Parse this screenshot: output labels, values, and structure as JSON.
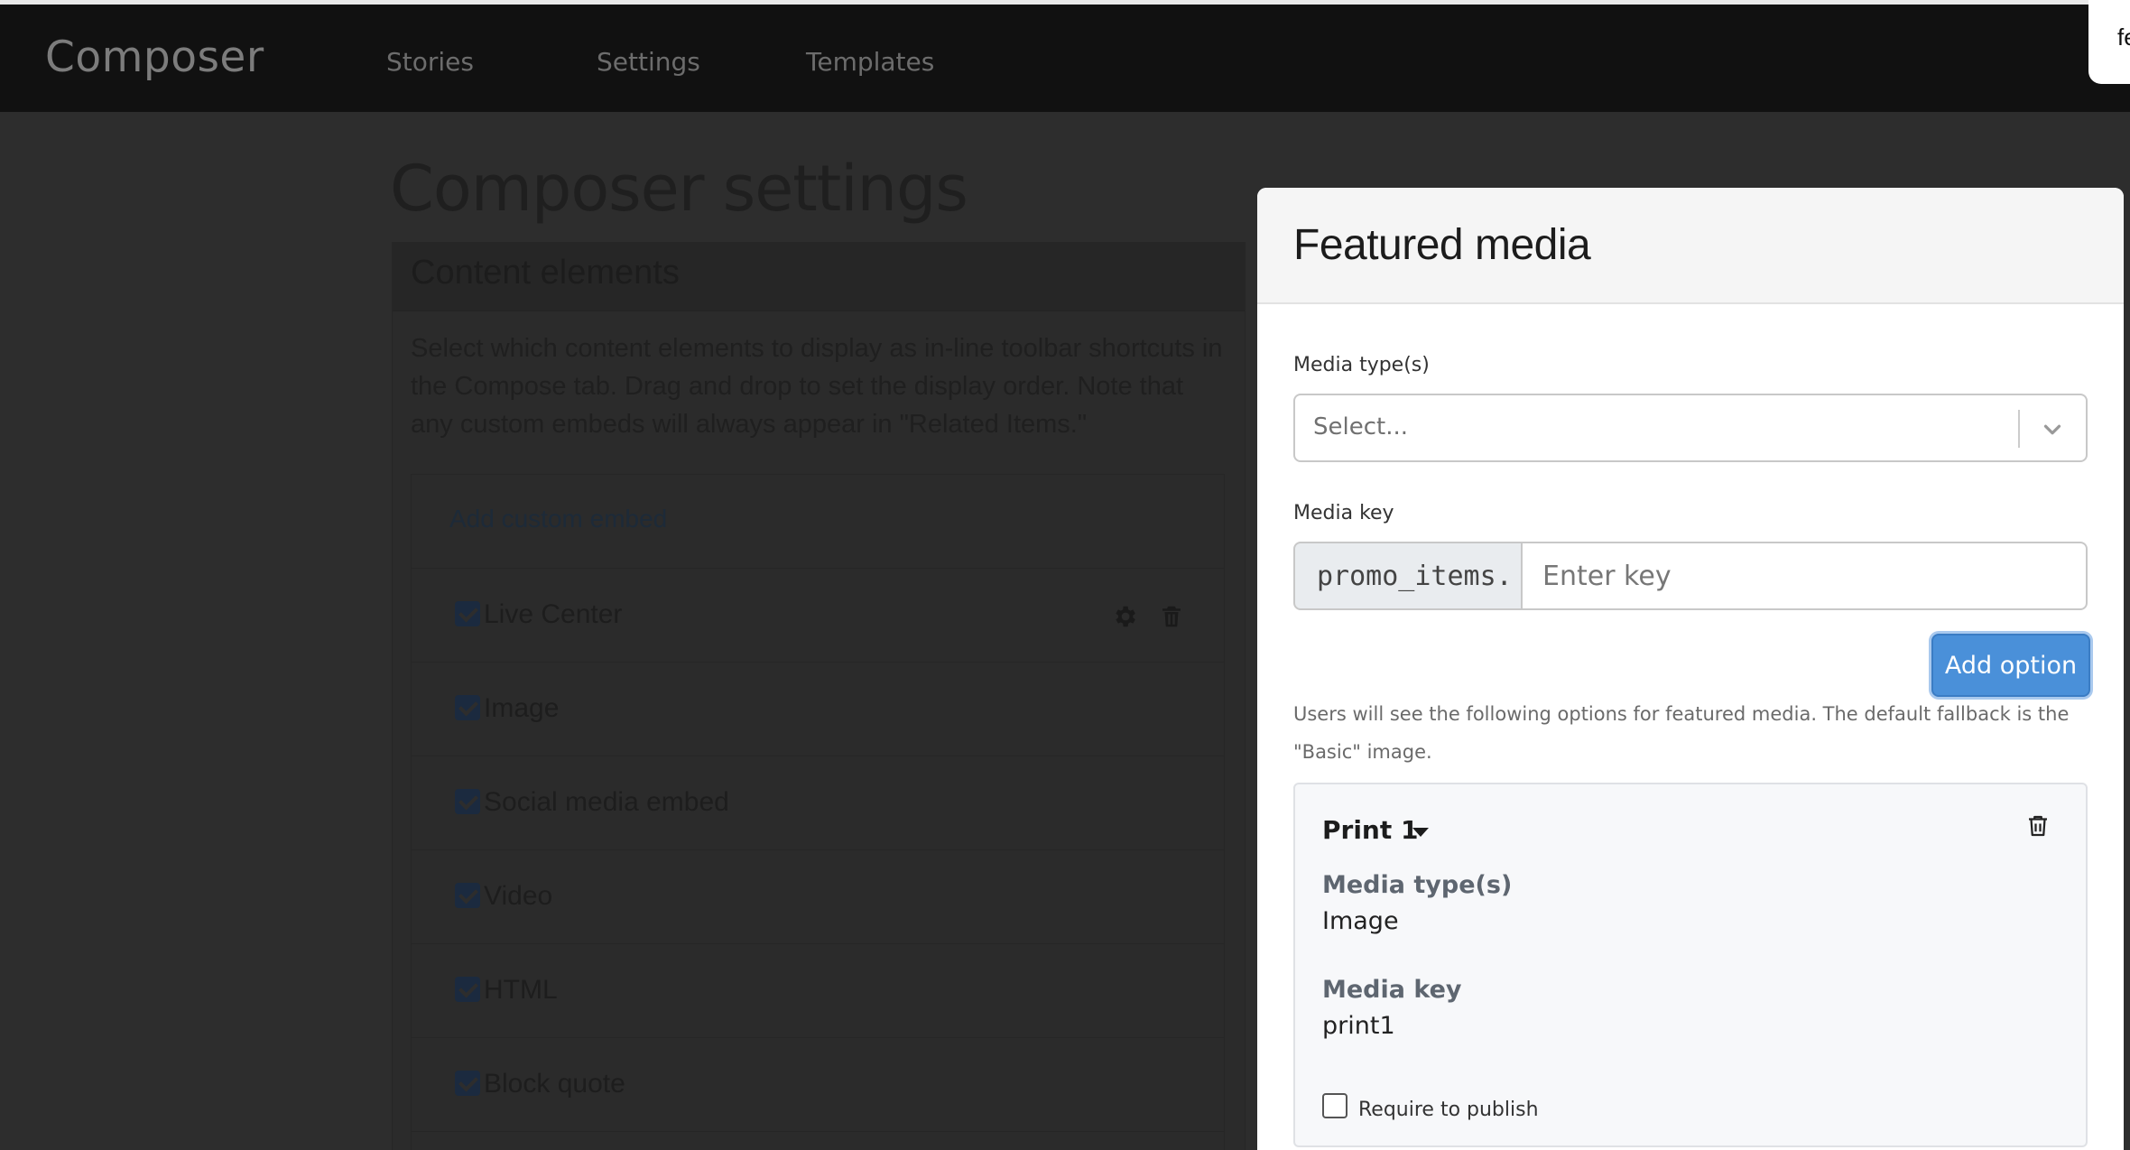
{
  "app": {
    "brand": "Composer",
    "nav": [
      "Stories",
      "Settings",
      "Templates"
    ],
    "toast_text": "fe"
  },
  "background_page": {
    "title": "Composer settings",
    "section_title": "Content elements",
    "description": "Select which content elements to display as in-line toolbar shortcuts in the Compose tab. Drag and drop to set the display order. Note that any custom embeds will always appear in \"Related Items.\"",
    "add_custom_embed": "Add custom embed",
    "elements": [
      {
        "label": "Live Center",
        "checked": true
      },
      {
        "label": "Image",
        "checked": true
      },
      {
        "label": "Social media embed",
        "checked": true
      },
      {
        "label": "Video",
        "checked": true
      },
      {
        "label": "HTML",
        "checked": true
      },
      {
        "label": "Block quote",
        "checked": true
      }
    ],
    "icons": {
      "settings": "gear-icon",
      "delete": "trash-icon"
    }
  },
  "modal": {
    "title": "Featured media",
    "media_type_label": "Media type(s)",
    "media_type_placeholder": "Select...",
    "media_key_label": "Media key",
    "media_key_prefix": "promo_items.",
    "media_key_placeholder": "Enter key",
    "add_option": "Add option",
    "help_text": "Users will see the following options for featured media. The default fallback is the \"Basic\" image.",
    "option_card": {
      "title": "Print 1",
      "media_type_label": "Media type(s)",
      "media_type_value": "Image",
      "media_key_label": "Media key",
      "media_key_value": "print1",
      "require_label": "Require to publish",
      "require_checked": false
    },
    "colors": {
      "primary_button": "#4a90d9",
      "overlay": "#2d2d2d"
    }
  }
}
